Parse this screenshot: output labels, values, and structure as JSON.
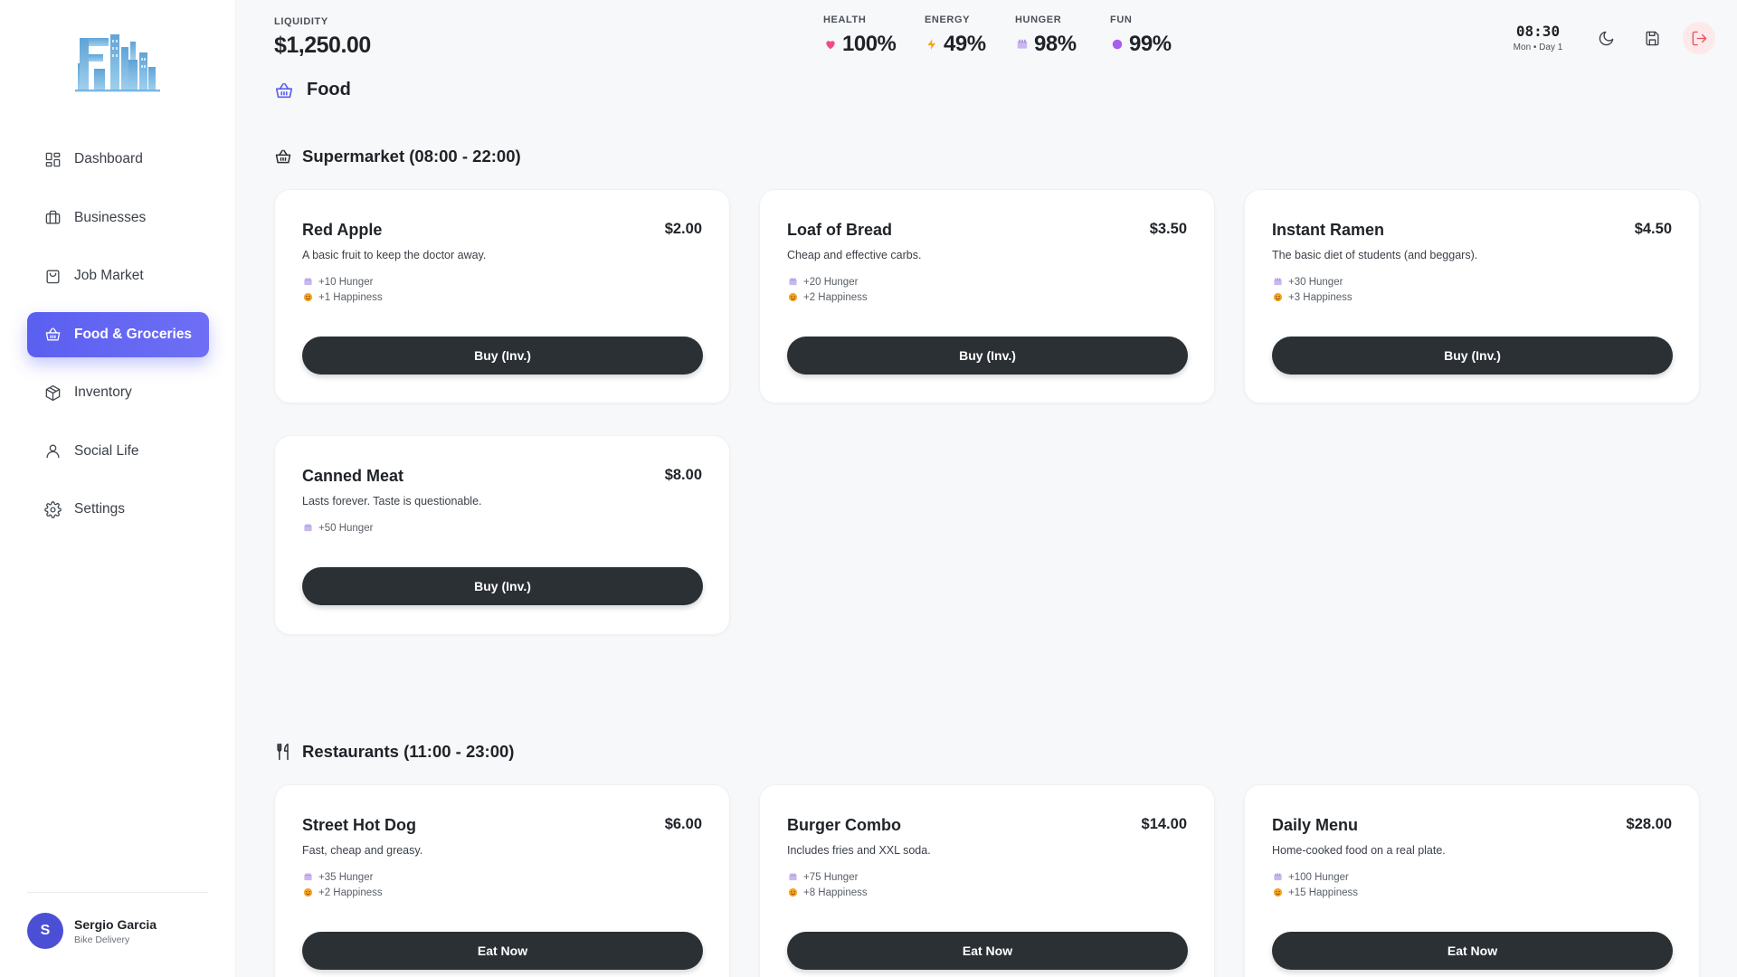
{
  "header": {
    "liquidity_label": "LIQUIDITY",
    "liquidity_value": "$1,250.00",
    "stats": [
      {
        "label": "HEALTH",
        "value": "100%",
        "icon": "heart-icon",
        "color": "#ec4d8a"
      },
      {
        "label": "ENERGY",
        "value": "49%",
        "icon": "bolt-icon",
        "color": "#f5a524"
      },
      {
        "label": "HUNGER",
        "value": "98%",
        "icon": "plate-icon",
        "color": "#a78bde"
      },
      {
        "label": "FUN",
        "value": "99%",
        "icon": "dot-icon",
        "color": "#a95ef0"
      }
    ],
    "time": "08:30",
    "day": "Mon • Day 1"
  },
  "sidebar": {
    "items": [
      {
        "label": "Dashboard",
        "icon": "grid-icon"
      },
      {
        "label": "Businesses",
        "icon": "briefcase-icon"
      },
      {
        "label": "Job Market",
        "icon": "bag-icon"
      },
      {
        "label": "Food & Groceries",
        "icon": "basket-icon",
        "active": true
      },
      {
        "label": "Inventory",
        "icon": "box-icon"
      },
      {
        "label": "Social Life",
        "icon": "user-icon"
      },
      {
        "label": "Settings",
        "icon": "gear-icon"
      }
    ],
    "user": {
      "initial": "S",
      "name": "Sergio Garcia",
      "role": "Bike Delivery"
    }
  },
  "page": {
    "title": "Food"
  },
  "supermarket": {
    "title": "Supermarket (08:00 - 22:00)",
    "items": [
      {
        "name": "Red Apple",
        "price": "$2.00",
        "desc": "A basic fruit to keep the doctor away.",
        "hunger": "+10 Hunger",
        "happiness": "+1 Happiness",
        "button": "Buy (Inv.)"
      },
      {
        "name": "Loaf of Bread",
        "price": "$3.50",
        "desc": "Cheap and effective carbs.",
        "hunger": "+20 Hunger",
        "happiness": "+2 Happiness",
        "button": "Buy (Inv.)"
      },
      {
        "name": "Instant Ramen",
        "price": "$4.50",
        "desc": "The basic diet of students (and beggars).",
        "hunger": "+30 Hunger",
        "happiness": "+3 Happiness",
        "button": "Buy (Inv.)"
      },
      {
        "name": "Canned Meat",
        "price": "$8.00",
        "desc": "Lasts forever. Taste is questionable.",
        "hunger": "+50 Hunger",
        "button": "Buy (Inv.)"
      }
    ]
  },
  "restaurants": {
    "title": "Restaurants (11:00 - 23:00)",
    "items": [
      {
        "name": "Street Hot Dog",
        "price": "$6.00",
        "desc": "Fast, cheap and greasy.",
        "hunger": "+35 Hunger",
        "happiness": "+2 Happiness",
        "button": "Eat Now"
      },
      {
        "name": "Burger Combo",
        "price": "$14.00",
        "desc": "Includes fries and XXL soda.",
        "hunger": "+75 Hunger",
        "happiness": "+8 Happiness",
        "button": "Eat Now"
      },
      {
        "name": "Daily Menu",
        "price": "$28.00",
        "desc": "Home-cooked food on a real plate.",
        "hunger": "+100 Hunger",
        "happiness": "+15 Happiness",
        "button": "Eat Now"
      }
    ]
  }
}
